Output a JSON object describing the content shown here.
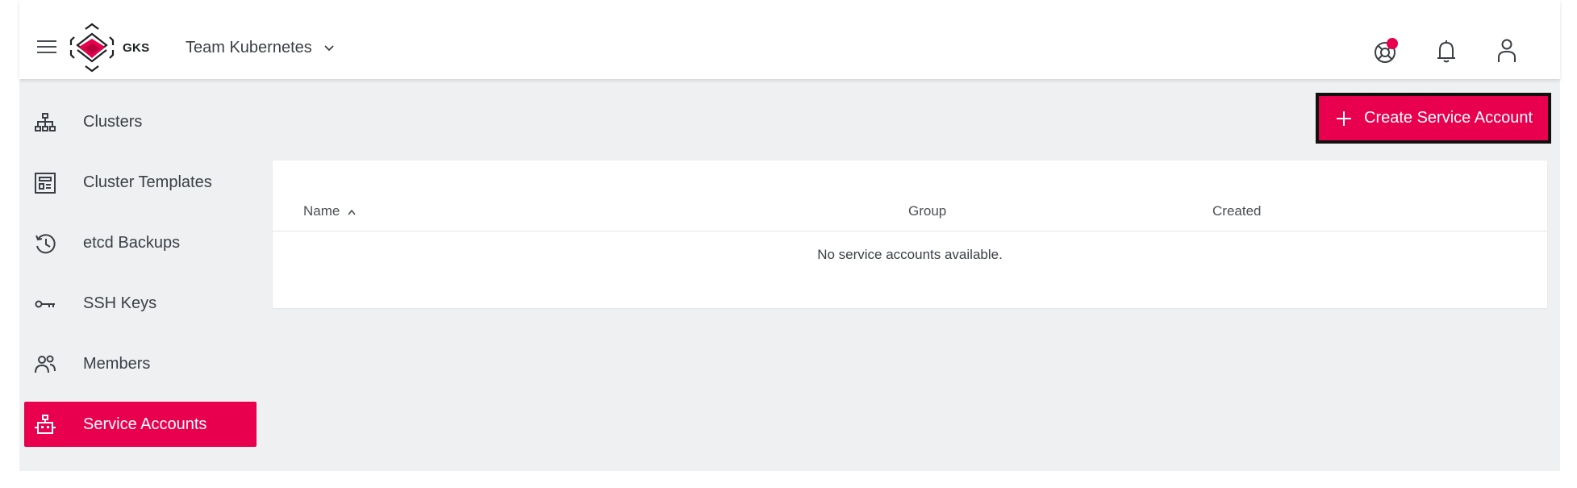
{
  "header": {
    "brand_text": "GKS",
    "team_name": "Team Kubernetes",
    "icons": [
      "menu-icon",
      "chevron-down-icon",
      "support-icon",
      "bell-icon",
      "user-icon"
    ],
    "notification_dot_color": "#e8004e"
  },
  "sidebar": {
    "items": [
      {
        "label": "Clusters",
        "icon": "sitemap-icon",
        "active": false
      },
      {
        "label": "Cluster Templates",
        "icon": "template-icon",
        "active": false
      },
      {
        "label": "etcd Backups",
        "icon": "history-icon",
        "active": false
      },
      {
        "label": "SSH Keys",
        "icon": "key-icon",
        "active": false
      },
      {
        "label": "Members",
        "icon": "members-icon",
        "active": false
      },
      {
        "label": "Service Accounts",
        "icon": "robot-icon",
        "active": true
      }
    ]
  },
  "actions": {
    "create_label": "Create Service Account"
  },
  "table": {
    "columns": [
      {
        "label": "Name",
        "sort": "ascending"
      },
      {
        "label": "Group"
      },
      {
        "label": "Created"
      }
    ],
    "empty_message": "No service accounts available."
  },
  "colors": {
    "accent": "#e8004e",
    "background": "#eef0f2",
    "text": "#3b3f45"
  }
}
